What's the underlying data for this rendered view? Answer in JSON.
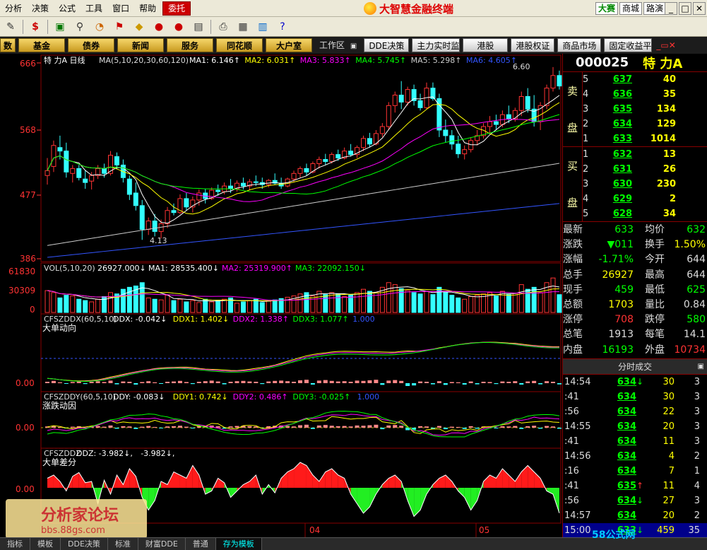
{
  "menu": [
    "分析",
    "决策",
    "公式",
    "工具",
    "窗口",
    "帮助"
  ],
  "menu_entrust": "委托",
  "brand": "大智慧金融终端",
  "top_links": [
    "大赛",
    "商城",
    "路演"
  ],
  "function_buttons": [
    "数",
    "基金",
    "债券",
    "新闻",
    "服务",
    "同花顺",
    "大户室"
  ],
  "workspace_label": "工作区",
  "module_buttons": [
    "DDE决策",
    "主力实时监控",
    "港股",
    "港股权证",
    "商品市场",
    "固定收益平台"
  ],
  "main_panel": {
    "title_prefix": "特 力A 日线",
    "ma_label": "MA(5,10,20,30,60,120)",
    "ma_items": [
      {
        "label": "MA1: 6.146↑",
        "color": "#ffffff"
      },
      {
        "label": "MA2: 6.031↑",
        "color": "#ffff00"
      },
      {
        "label": "MA3: 5.833↑",
        "color": "#ff00ff"
      },
      {
        "label": "MA4: 5.745↑",
        "color": "#00ff00"
      },
      {
        "label": "MA5: 5.298↑",
        "color": "#cccccc"
      },
      {
        "label": "MA6: 4.605↑",
        "color": "#3355ff"
      }
    ],
    "y_ticks": [
      "666",
      "568",
      "477",
      "386"
    ],
    "high_label": "6.60",
    "low_label": "4.13"
  },
  "vol_panel": {
    "label": "VOL(5,10,20)",
    "items": [
      {
        "label": "26927.000↓",
        "color": "#ffffff"
      },
      {
        "label": "MA1: 28535.400↓",
        "color": "#ffffff"
      },
      {
        "label": "MA2: 25319.900↑",
        "color": "#ff00ff"
      },
      {
        "label": "MA3: 22092.150↓",
        "color": "#00ff00"
      }
    ],
    "y_ticks": [
      "61830",
      "30309",
      "0"
    ]
  },
  "ddx_panel": {
    "label": "CFSZDDX(60,5,10)",
    "title": "大单动向",
    "items": [
      {
        "label": "DDX: -0.042↓",
        "color": "#ffffff"
      },
      {
        "label": "DDX1: 1.402↓",
        "color": "#ffff00"
      },
      {
        "label": "DDX2: 1.338↑",
        "color": "#ff00ff"
      },
      {
        "label": "DDX3: 1.077↑",
        "color": "#00ff00"
      },
      {
        "label": "1.000",
        "color": "#3355ff"
      }
    ],
    "y_tick": "0.00"
  },
  "ddy_panel": {
    "label": "CFSZDDY(60,5,10)",
    "title": "涨跌动因",
    "items": [
      {
        "label": "DDY: -0.083↓",
        "color": "#ffffff"
      },
      {
        "label": "DDY1: 0.742↓",
        "color": "#ffff00"
      },
      {
        "label": "DDY2: 0.486↑",
        "color": "#ff00ff"
      },
      {
        "label": "DDY3: -0.025↑",
        "color": "#00ff00"
      },
      {
        "label": "1.000",
        "color": "#3355ff"
      }
    ],
    "y_tick": "0.00"
  },
  "ddz_panel": {
    "label": "CFSZDDZ",
    "title": "大单差分",
    "items": [
      {
        "label": "DDZ: -3.982↓,",
        "color": "#ffffff"
      },
      {
        "label": "-3.982↓,",
        "color": "#ffffff"
      }
    ],
    "y_tick": "0.00"
  },
  "x_axis_labels": [
    "04",
    "05"
  ],
  "stock": {
    "code": "000025",
    "name": "特 力A"
  },
  "sell_side_label": [
    "卖",
    "盘"
  ],
  "buy_side_label": [
    "买",
    "盘"
  ],
  "sells": [
    {
      "lv": "5",
      "price": "637",
      "vol": "40"
    },
    {
      "lv": "4",
      "price": "636",
      "vol": "35"
    },
    {
      "lv": "3",
      "price": "635",
      "vol": "134"
    },
    {
      "lv": "2",
      "price": "634",
      "vol": "129"
    },
    {
      "lv": "1",
      "price": "633",
      "vol": "1014"
    }
  ],
  "buys": [
    {
      "lv": "1",
      "price": "632",
      "vol": "13"
    },
    {
      "lv": "2",
      "price": "631",
      "vol": "26"
    },
    {
      "lv": "3",
      "price": "630",
      "vol": "230"
    },
    {
      "lv": "4",
      "price": "629",
      "vol": "2"
    },
    {
      "lv": "5",
      "price": "628",
      "vol": "34"
    }
  ],
  "stats": [
    {
      "l1": "最新",
      "v1": "633",
      "c1": "g",
      "l2": "均价",
      "v2": "632",
      "c2": "g"
    },
    {
      "l1": "涨跌",
      "v1": "▼011",
      "c1": "g",
      "l2": "换手",
      "v2": "1.50%",
      "c2": "y"
    },
    {
      "l1": "涨幅",
      "v1": "-1.71%",
      "c1": "g",
      "l2": "今开",
      "v2": "644",
      "c2": "w"
    },
    {
      "l1": "总手",
      "v1": "26927",
      "c1": "y",
      "l2": "最高",
      "v2": "644",
      "c2": "w"
    },
    {
      "l1": "现手",
      "v1": "459",
      "c1": "g",
      "l2": "最低",
      "v2": "625",
      "c2": "g"
    },
    {
      "l1": "总额",
      "v1": "1703",
      "c1": "y",
      "l2": "量比",
      "v2": "0.84",
      "c2": "w"
    },
    {
      "l1": "涨停",
      "v1": "708",
      "c1": "r",
      "l2": "跌停",
      "v2": "580",
      "c2": "g"
    },
    {
      "l1": "总笔",
      "v1": "1913",
      "c1": "w",
      "l2": "每笔",
      "v2": "14.1",
      "c2": "w"
    },
    {
      "l1": "内盘",
      "v1": "16193",
      "c1": "g",
      "l2": "外盘",
      "v2": "10734",
      "c2": "r"
    }
  ],
  "trade_header": "分时成交",
  "trades": [
    {
      "t": "14:54",
      "p": "634",
      "a": "↓",
      "ac": "g",
      "v": "30",
      "n": "3"
    },
    {
      "t": ":41",
      "p": "634",
      "a": "",
      "ac": "g",
      "v": "30",
      "n": "3"
    },
    {
      "t": ":56",
      "p": "634",
      "a": "",
      "ac": "g",
      "v": "22",
      "n": "3"
    },
    {
      "t": "14:55",
      "p": "634",
      "a": "",
      "ac": "g",
      "v": "20",
      "n": "3"
    },
    {
      "t": ":41",
      "p": "634",
      "a": "",
      "ac": "g",
      "v": "11",
      "n": "3"
    },
    {
      "t": "14:56",
      "p": "634",
      "a": "",
      "ac": "g",
      "v": "4",
      "n": "2"
    },
    {
      "t": ":16",
      "p": "634",
      "a": "",
      "ac": "g",
      "v": "7",
      "n": "1"
    },
    {
      "t": ":41",
      "p": "635",
      "a": "↑",
      "ac": "r",
      "v": "11",
      "n": "4"
    },
    {
      "t": ":56",
      "p": "634",
      "a": "↓",
      "ac": "g",
      "v": "27",
      "n": "3"
    },
    {
      "t": "14:57",
      "p": "634",
      "a": "",
      "ac": "g",
      "v": "20",
      "n": "2"
    },
    {
      "t": "15:00",
      "p": "633",
      "a": "↓",
      "ac": "g",
      "v": "459",
      "n": "35"
    }
  ],
  "status_tabs": [
    "指标",
    "模板",
    "DDE决策",
    "标准",
    "财富DDE",
    "普通",
    "存为模板"
  ],
  "status_active": "存为模板",
  "watermark": {
    "title": "分析家论坛",
    "url": "bbs.88gs.com"
  },
  "watermark2": "58公式网",
  "chart_data": {
    "type": "candlestick",
    "title": "特 力A 日线",
    "ohlc": [
      [
        5.05,
        5.3,
        4.92,
        5.12
      ],
      [
        5.18,
        5.55,
        5.1,
        5.48
      ],
      [
        5.45,
        5.62,
        5.28,
        5.4
      ],
      [
        5.4,
        5.52,
        5.02,
        5.1
      ],
      [
        5.08,
        5.2,
        4.95,
        5.15
      ],
      [
        5.15,
        5.2,
        4.98,
        5.02
      ],
      [
        5.0,
        5.12,
        4.86,
        4.95
      ],
      [
        4.97,
        5.1,
        4.85,
        5.05
      ],
      [
        5.05,
        5.2,
        5.0,
        5.15
      ],
      [
        5.15,
        5.22,
        5.02,
        5.08
      ],
      [
        5.08,
        5.4,
        5.05,
        5.34
      ],
      [
        5.32,
        5.38,
        5.15,
        5.2
      ],
      [
        5.2,
        5.28,
        4.95,
        5.02
      ],
      [
        5.0,
        5.05,
        4.7,
        4.78
      ],
      [
        4.8,
        4.95,
        4.55,
        4.62
      ],
      [
        4.62,
        4.7,
        4.13,
        4.28
      ],
      [
        4.28,
        4.45,
        4.2,
        4.4
      ],
      [
        4.4,
        4.5,
        4.18,
        4.25
      ],
      [
        4.25,
        4.42,
        4.15,
        4.36
      ],
      [
        4.36,
        4.6,
        4.3,
        4.55
      ],
      [
        4.55,
        4.65,
        4.48,
        4.52
      ],
      [
        4.52,
        4.78,
        4.5,
        4.72
      ],
      [
        4.72,
        4.8,
        4.55,
        4.6
      ],
      [
        4.6,
        4.75,
        4.52,
        4.7
      ],
      [
        4.7,
        4.85,
        4.62,
        4.8
      ],
      [
        4.8,
        4.86,
        4.65,
        4.72
      ],
      [
        4.72,
        4.88,
        4.7,
        4.84
      ],
      [
        4.84,
        4.92,
        4.76,
        4.82
      ],
      [
        4.82,
        4.95,
        4.78,
        4.9
      ],
      [
        4.9,
        5.0,
        4.8,
        4.86
      ],
      [
        4.86,
        4.98,
        4.82,
        4.94
      ],
      [
        4.94,
        5.02,
        4.85,
        4.9
      ],
      [
        4.9,
        5.0,
        4.84,
        4.96
      ],
      [
        4.96,
        5.05,
        4.9,
        4.95
      ],
      [
        4.95,
        5.02,
        4.86,
        4.92
      ],
      [
        4.92,
        5.0,
        4.88,
        4.98
      ],
      [
        4.98,
        5.08,
        4.92,
        4.94
      ],
      [
        4.94,
        5.02,
        4.86,
        4.9
      ],
      [
        4.9,
        5.02,
        4.88,
        5.0
      ],
      [
        5.0,
        5.12,
        4.96,
        5.08
      ],
      [
        5.08,
        5.18,
        5.02,
        5.15
      ],
      [
        5.15,
        5.22,
        5.05,
        5.1
      ],
      [
        5.1,
        5.25,
        5.08,
        5.22
      ],
      [
        5.22,
        5.32,
        5.15,
        5.28
      ],
      [
        5.28,
        5.36,
        5.2,
        5.25
      ],
      [
        5.25,
        5.38,
        5.22,
        5.35
      ],
      [
        5.35,
        5.42,
        5.26,
        5.3
      ],
      [
        5.3,
        5.45,
        5.28,
        5.4
      ],
      [
        5.4,
        5.5,
        5.32,
        5.35
      ],
      [
        5.35,
        5.48,
        5.3,
        5.45
      ],
      [
        5.45,
        5.62,
        5.4,
        5.58
      ],
      [
        5.58,
        5.66,
        5.45,
        5.5
      ],
      [
        5.5,
        5.7,
        5.48,
        5.65
      ],
      [
        5.65,
        5.8,
        5.6,
        5.75
      ],
      [
        5.75,
        6.1,
        5.7,
        6.05
      ],
      [
        6.05,
        6.25,
        5.95,
        6.2
      ],
      [
        6.2,
        6.4,
        6.0,
        6.1
      ],
      [
        6.1,
        6.32,
        6.05,
        6.28
      ],
      [
        6.28,
        6.35,
        6.05,
        6.12
      ],
      [
        6.12,
        6.22,
        5.98,
        6.02
      ],
      [
        6.02,
        6.38,
        6.0,
        6.3
      ],
      [
        6.3,
        6.38,
        6.12,
        6.15
      ],
      [
        6.15,
        6.22,
        5.6,
        5.7
      ],
      [
        5.7,
        5.85,
        5.52,
        5.62
      ],
      [
        5.62,
        5.7,
        5.42,
        5.5
      ],
      [
        5.5,
        5.62,
        5.3,
        5.36
      ],
      [
        5.36,
        5.48,
        5.28,
        5.42
      ],
      [
        5.42,
        5.6,
        5.38,
        5.55
      ],
      [
        5.55,
        5.7,
        5.48,
        5.62
      ],
      [
        5.62,
        5.8,
        5.58,
        5.75
      ],
      [
        5.75,
        5.9,
        5.66,
        5.82
      ],
      [
        5.82,
        5.92,
        5.7,
        5.78
      ],
      [
        5.78,
        5.98,
        5.74,
        5.92
      ],
      [
        5.92,
        6.05,
        5.8,
        5.86
      ],
      [
        5.86,
        6.02,
        5.82,
        5.98
      ],
      [
        5.98,
        6.25,
        5.9,
        6.18
      ],
      [
        6.18,
        6.3,
        5.95,
        6.0
      ],
      [
        6.0,
        6.2,
        5.75,
        5.82
      ],
      [
        5.82,
        6.1,
        5.7,
        6.05
      ],
      [
        6.05,
        6.35,
        6.0,
        6.3
      ],
      [
        6.3,
        6.6,
        6.25,
        6.48
      ],
      [
        6.48,
        6.55,
        6.28,
        6.33
      ]
    ],
    "volume": [
      33000,
      30000,
      22000,
      26000,
      25000,
      20000,
      18000,
      16000,
      20000,
      24000,
      30000,
      28000,
      35000,
      38000,
      40000,
      45000,
      22000,
      20000,
      19000,
      26000,
      18000,
      20000,
      16000,
      18000,
      15000,
      20000,
      16000,
      18000,
      20000,
      22000,
      14000,
      16000,
      18000,
      20000,
      15000,
      17000,
      19000,
      21000,
      23000,
      25000,
      28000,
      30000,
      25000,
      32000,
      27000,
      30000,
      28000,
      24000,
      26000,
      30000,
      35000,
      32000,
      30000,
      38000,
      45000,
      42000,
      36000,
      33000,
      30000,
      28000,
      32000,
      27000,
      38000,
      30000,
      26000,
      22000,
      20000,
      24000,
      26000,
      28000,
      30000,
      25000,
      32000,
      27000,
      29000,
      42000,
      35000,
      38000,
      30000,
      45000,
      52000,
      26927
    ],
    "ddx": [
      0.05,
      0.08,
      0.03,
      -0.02,
      0.04,
      0.06,
      -0.03,
      0.05,
      0.07,
      0.04,
      0.09,
      -0.04,
      0.06,
      0.05,
      -0.05,
      0.04,
      0.07,
      0.03,
      -0.02,
      0.05,
      0.06,
      0.08,
      0.04,
      -0.03,
      0.05,
      0.07,
      0.09,
      0.06,
      -0.04,
      0.05,
      0.07,
      0.08,
      0.06,
      0.05,
      -0.03,
      0.06,
      0.08,
      0.09,
      0.07,
      0.05,
      0.1,
      0.12,
      -0.05,
      0.09,
      0.11,
      0.08,
      0.06,
      0.07,
      0.05,
      0.09,
      0.08,
      0.1,
      0.12,
      -0.06,
      0.09,
      0.11,
      0.08,
      -0.1,
      -0.08,
      0.06,
      0.05,
      -0.04,
      0.07,
      -0.06,
      0.04,
      0.03,
      -0.05,
      0.06,
      -0.04,
      0.05,
      0.04,
      -0.03,
      0.06,
      0.05,
      0.07,
      -0.05,
      0.06,
      0.08,
      -0.04,
      0.07,
      0.05,
      -0.042
    ],
    "ddz": [
      1.5,
      2.0,
      1.0,
      -0.5,
      1.8,
      2.4,
      0.8,
      1.0,
      -2.5,
      1.2,
      -1.0,
      2.0,
      0.5,
      3.0,
      1.8,
      -1.5,
      -3.5,
      -2.0,
      1.0,
      0.5,
      2.5,
      2.0,
      1.5,
      3.5,
      2.0,
      -1.0,
      -0.5,
      1.5,
      0.8,
      -1.5,
      -0.5,
      0.5,
      1.0,
      2.0,
      -1.0,
      0.5,
      -0.8,
      1.5,
      2.5,
      3.0,
      4.0,
      3.5,
      2.0,
      1.0,
      2.5,
      3.0,
      2.0,
      1.5,
      -1.0,
      -2.5,
      -4.0,
      -3.0,
      -1.0,
      0.5,
      1.5,
      2.0,
      1.0,
      -2.0,
      -4.5,
      -3.5,
      -1.0,
      0.5,
      1.5,
      2.0,
      1.0,
      -0.5,
      -1.5,
      -3.5,
      -2.0,
      1.0,
      2.0,
      1.5,
      3.0,
      2.0,
      1.0,
      2.5,
      3.5,
      2.5,
      1.5,
      -0.5,
      -1.0,
      -3.982
    ]
  }
}
